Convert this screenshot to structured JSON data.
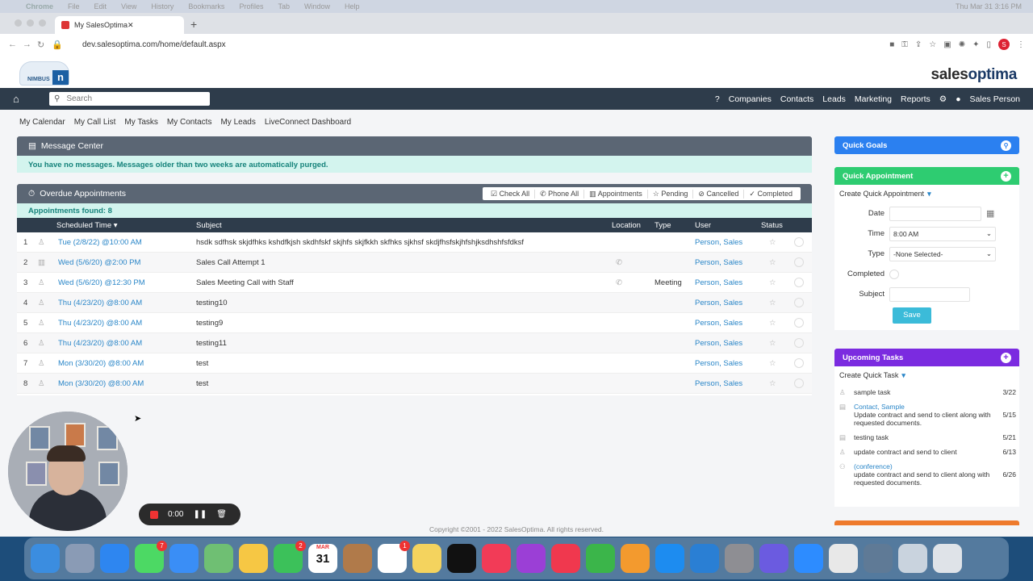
{
  "mac_menu": {
    "app": "Chrome",
    "items": [
      "File",
      "Edit",
      "View",
      "History",
      "Bookmarks",
      "Profiles",
      "Tab",
      "Window",
      "Help"
    ],
    "clock": "Thu Mar 31  3:16 PM"
  },
  "browser": {
    "tab_title": "My SalesOptima",
    "url": "dev.salesoptima.com/home/default.aspx",
    "profile_letter": "S"
  },
  "brand": {
    "nimbus_text": "NIMBUS",
    "nimbus_mark": "n",
    "logo_a": "sales",
    "logo_b": "optima"
  },
  "nav": {
    "search_placeholder": "Search",
    "help": "?",
    "companies": "Companies",
    "contacts": "Contacts",
    "leads": "Leads",
    "marketing": "Marketing",
    "reports": "Reports",
    "user": "Sales Person"
  },
  "subnav": [
    "My Calendar",
    "My Call List",
    "My Tasks",
    "My Contacts",
    "My Leads",
    "LiveConnect Dashboard"
  ],
  "message_center": {
    "title": "Message Center",
    "text": "You have no messages. Messages older than two weeks are automatically purged."
  },
  "overdue": {
    "title": "Overdue Appointments",
    "filters": [
      "Check All",
      "Phone All",
      "Appointments",
      "Pending",
      "Cancelled",
      "Completed"
    ],
    "found": "Appointments found: 8",
    "columns": [
      "Scheduled Time ▾",
      "Subject",
      "Location",
      "Type",
      "User",
      "Status"
    ],
    "rows": [
      {
        "n": "1",
        "time": "Tue (2/8/22) @10:00 AM",
        "subject": "hsdk sdfhsk skjdfhks kshdfkjsh skdhfskf skjhfs skjfkkh skfhks sjkhsf skdjfhsfskjhfshjksdhshfsfdksf",
        "phone": false,
        "type": "",
        "user": "Person, Sales"
      },
      {
        "n": "2",
        "time": "Wed (5/6/20) @2:00 PM",
        "subject": "Sales Call Attempt 1",
        "phone": true,
        "type": "",
        "user": "Person, Sales"
      },
      {
        "n": "3",
        "time": "Wed (5/6/20) @12:30 PM",
        "subject": "Sales Meeting Call with Staff",
        "phone": true,
        "type": "Meeting",
        "user": "Person, Sales"
      },
      {
        "n": "4",
        "time": "Thu (4/23/20) @8:00 AM",
        "subject": "testing10",
        "phone": false,
        "type": "",
        "user": "Person, Sales"
      },
      {
        "n": "5",
        "time": "Thu (4/23/20) @8:00 AM",
        "subject": "testing9",
        "phone": false,
        "type": "",
        "user": "Person, Sales"
      },
      {
        "n": "6",
        "time": "Thu (4/23/20) @8:00 AM",
        "subject": "testing11",
        "phone": false,
        "type": "",
        "user": "Person, Sales"
      },
      {
        "n": "7",
        "time": "Mon (3/30/20) @8:00 AM",
        "subject": "test",
        "phone": false,
        "type": "",
        "user": "Person, Sales"
      },
      {
        "n": "8",
        "time": "Mon (3/30/20) @8:00 AM",
        "subject": "test",
        "phone": false,
        "type": "",
        "user": "Person, Sales"
      }
    ]
  },
  "quick_goals": {
    "title": "Quick Goals"
  },
  "quick_appointment": {
    "title": "Quick Appointment",
    "create": "Create Quick Appointment",
    "date_label": "Date",
    "date_value": "",
    "time_label": "Time",
    "time_value": "8:00 AM",
    "type_label": "Type",
    "type_value": "-None Selected-",
    "completed_label": "Completed",
    "subject_label": "Subject",
    "subject_value": "",
    "save": "Save"
  },
  "upcoming_tasks": {
    "title": "Upcoming Tasks",
    "create": "Create Quick Task",
    "tasks": [
      {
        "link": "",
        "text": "sample task",
        "date": "3/22"
      },
      {
        "link": "Contact, Sample",
        "text": "Update contract and send to client along with requested documents.",
        "date": "5/15"
      },
      {
        "link": "",
        "text": "testing task",
        "date": "5/21"
      },
      {
        "link": "",
        "text": "update contract and send to client",
        "date": "6/13"
      },
      {
        "link": "(conference)",
        "text": "update contract and send to client along with requested documents.",
        "date": "6/26"
      }
    ]
  },
  "footer": "Copyright ©2001 - 2022 SalesOptima. All rights reserved.",
  "recorder": {
    "time": "0:00"
  },
  "dock": {
    "calendar_month": "MAR",
    "calendar_day": "31",
    "badges": {
      "messages": "7",
      "facetime": "2",
      "reminders": "1"
    }
  }
}
